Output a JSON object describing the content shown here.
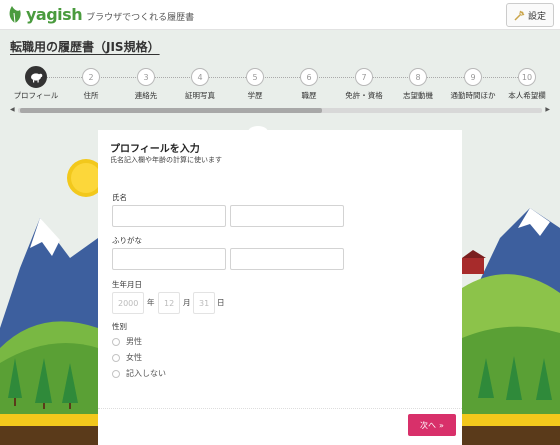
{
  "header": {
    "brand": "yagish",
    "tagline": "ブラウザでつくれる履歴書",
    "settings_label": "設定"
  },
  "page_title": "転職用の履歴書（JIS規格）",
  "steps": [
    {
      "number": "",
      "label": "プロフィール"
    },
    {
      "number": "2",
      "label": "住所"
    },
    {
      "number": "3",
      "label": "連絡先"
    },
    {
      "number": "4",
      "label": "証明写真"
    },
    {
      "number": "5",
      "label": "学歴"
    },
    {
      "number": "6",
      "label": "職歴"
    },
    {
      "number": "7",
      "label": "免許・資格"
    },
    {
      "number": "8",
      "label": "志望動機"
    },
    {
      "number": "9",
      "label": "通勤時間ほか"
    },
    {
      "number": "10",
      "label": "本人希望欄"
    }
  ],
  "form": {
    "heading": "プロフィールを入力",
    "subheading": "氏名記入欄や年齢の計算に使います",
    "name_label": "氏名",
    "furigana_label": "ふりがな",
    "birthdate_label": "生年月日",
    "birth": {
      "year_placeholder": "2000",
      "year_unit": "年",
      "month_placeholder": "12",
      "month_unit": "月",
      "day_placeholder": "31",
      "day_unit": "日"
    },
    "gender_label": "性別",
    "gender_options": [
      "男性",
      "女性",
      "記入しない"
    ],
    "next_label": "次へ",
    "next_icon": "double-chevron-right-icon"
  },
  "colors": {
    "brand_green": "#4a9b3e",
    "next_button": "#d8306a",
    "active_step": "#333333"
  }
}
